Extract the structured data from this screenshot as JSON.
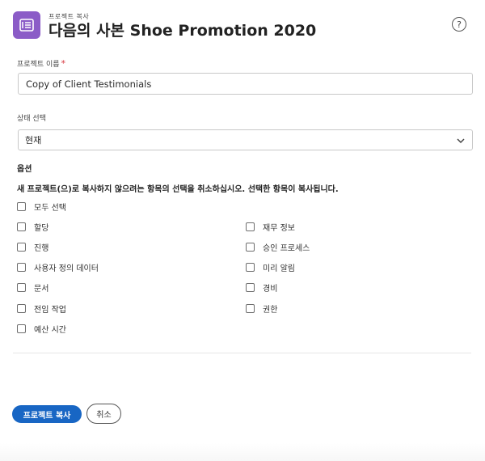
{
  "header": {
    "subtitle": "프로젝트 복사",
    "title": "다음의 사본 Shoe Promotion 2020",
    "help_symbol": "?",
    "accent_color": "#8b5cc7"
  },
  "form": {
    "project_name_label": "프로젝트 이름",
    "required_marker": "*",
    "project_name_value": "Copy of Client Testimonials",
    "status_label": "상태 선택",
    "status_value": "현재"
  },
  "options": {
    "title": "옵션",
    "instructions": "새 프로젝트(으)로 복사하지 않으려는 항목의 선택을 취소하십시오. 선택한 항목이 복사됩니다.",
    "select_all": "모두 선택",
    "left_column": [
      "할당",
      "진행",
      "사용자 정의 데이터",
      "문서",
      "전임 작업",
      "예산 시간"
    ],
    "right_column": [
      "재무 정보",
      "승인 프로세스",
      "미리 알림",
      "경비",
      "권한"
    ]
  },
  "footer": {
    "copy_button": "프로젝트 복사",
    "cancel_button": "취소",
    "primary_color": "#1866c4"
  }
}
